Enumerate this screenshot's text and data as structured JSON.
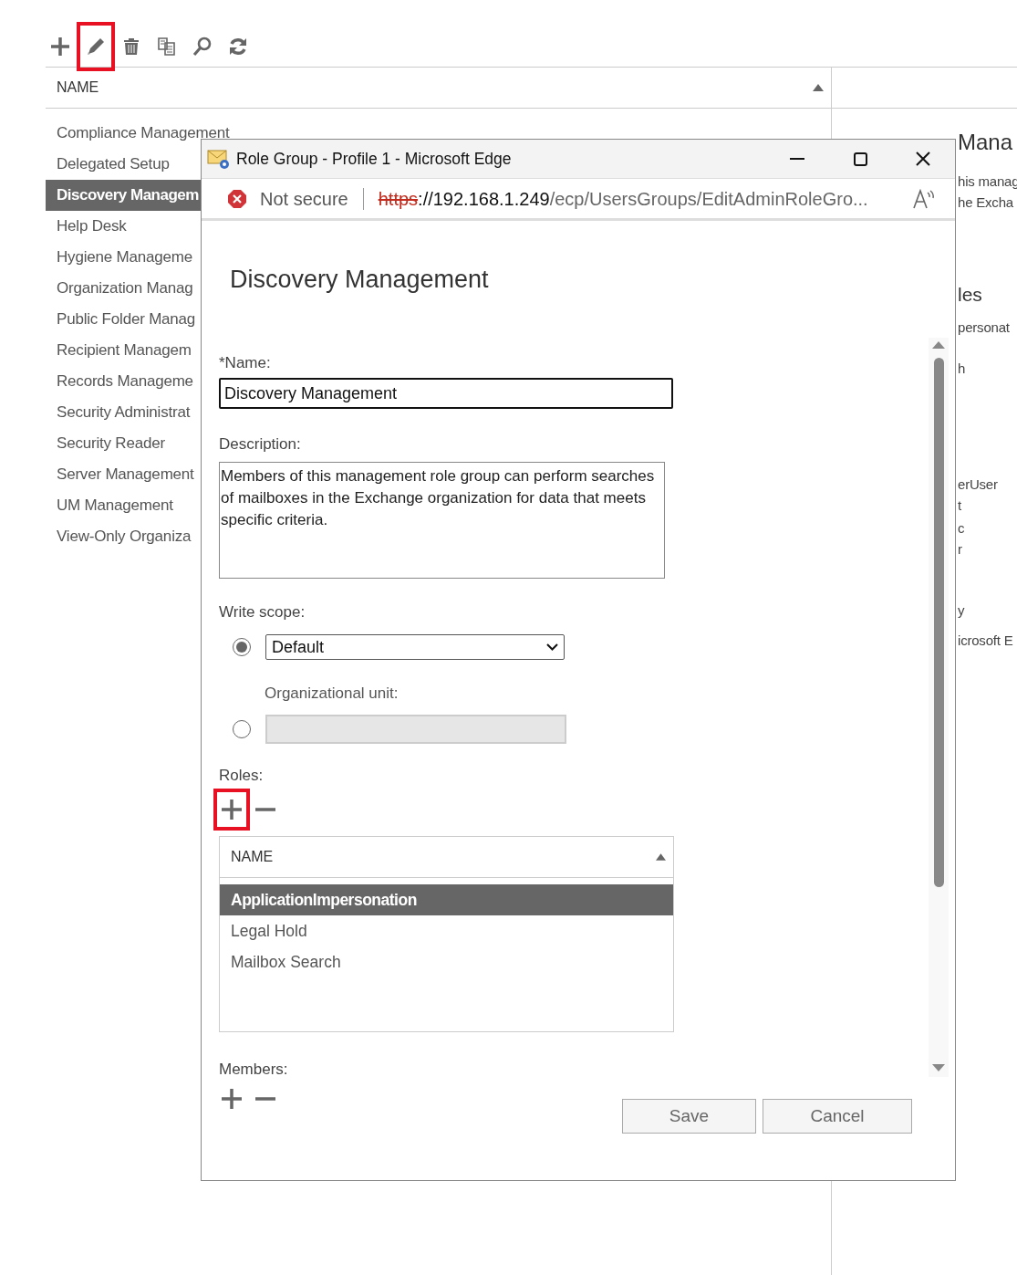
{
  "toolbar": [
    {
      "kind": "add",
      "highlighted": false
    },
    {
      "kind": "edit",
      "highlighted": true
    },
    {
      "kind": "delete",
      "highlighted": false
    },
    {
      "kind": "copy",
      "highlighted": false
    },
    {
      "kind": "search",
      "highlighted": false
    },
    {
      "kind": "refresh",
      "highlighted": false
    }
  ],
  "list": {
    "column": "NAME",
    "items": [
      {
        "label": "Compliance Management",
        "selected": false
      },
      {
        "label": "Delegated Setup",
        "selected": false
      },
      {
        "label": "Discovery Managem",
        "selected": true
      },
      {
        "label": "Help Desk",
        "selected": false
      },
      {
        "label": "Hygiene Manageme",
        "selected": false
      },
      {
        "label": "Organization Manag",
        "selected": false
      },
      {
        "label": "Public Folder Manag",
        "selected": false
      },
      {
        "label": "Recipient Managem",
        "selected": false
      },
      {
        "label": "Records Manageme",
        "selected": false
      },
      {
        "label": "Security Administrat",
        "selected": false
      },
      {
        "label": "Security Reader",
        "selected": false
      },
      {
        "label": "Server Management",
        "selected": false
      },
      {
        "label": "UM Management",
        "selected": false
      },
      {
        "label": "View-Only Organiza",
        "selected": false
      }
    ]
  },
  "details": [
    {
      "kind": "title",
      "text": "Mana"
    },
    {
      "kind": "text",
      "text": "his manag"
    },
    {
      "kind": "text",
      "text": "he Excha"
    },
    {
      "kind": "heading",
      "text": "les"
    },
    {
      "kind": "text",
      "text": "personat"
    },
    {
      "kind": "text",
      "text": "h"
    },
    {
      "kind": "text",
      "text": "erUser"
    },
    {
      "kind": "text",
      "text": "t"
    },
    {
      "kind": "text",
      "text": "c"
    },
    {
      "kind": "text",
      "text": "r"
    },
    {
      "kind": "text",
      "text": "y"
    },
    {
      "kind": "text",
      "text": "icrosoft E"
    }
  ],
  "popup": {
    "title": "Role Group - Profile 1 - Microsoft Edge",
    "security": "Not secure",
    "url_scheme": "https",
    "url_host": "://192.168.1.249",
    "url_path": "/ecp/UsersGroups/EditAdminRoleGro...",
    "heading": "Discovery Management",
    "name_label": "*Name:",
    "name_value": "Discovery Management",
    "description_label": "Description:",
    "description_value": "Members of this management role group can perform searches of mailboxes in the Exchange organization for data that meets specific criteria.",
    "write_scope_label": "Write scope:",
    "scope_default": {
      "selected": true,
      "value": "Default"
    },
    "scope_ou": {
      "selected": false,
      "label": "Organizational unit:"
    },
    "roles_label": "Roles:",
    "roles_add_highlighted": true,
    "roles": {
      "column": "NAME",
      "rows": [
        {
          "label": "ApplicationImpersonation",
          "selected": true
        },
        {
          "label": "Legal Hold",
          "selected": false
        },
        {
          "label": "Mailbox Search",
          "selected": false
        }
      ]
    },
    "members_label": "Members:",
    "buttons": [
      "Save",
      "Cancel"
    ]
  }
}
